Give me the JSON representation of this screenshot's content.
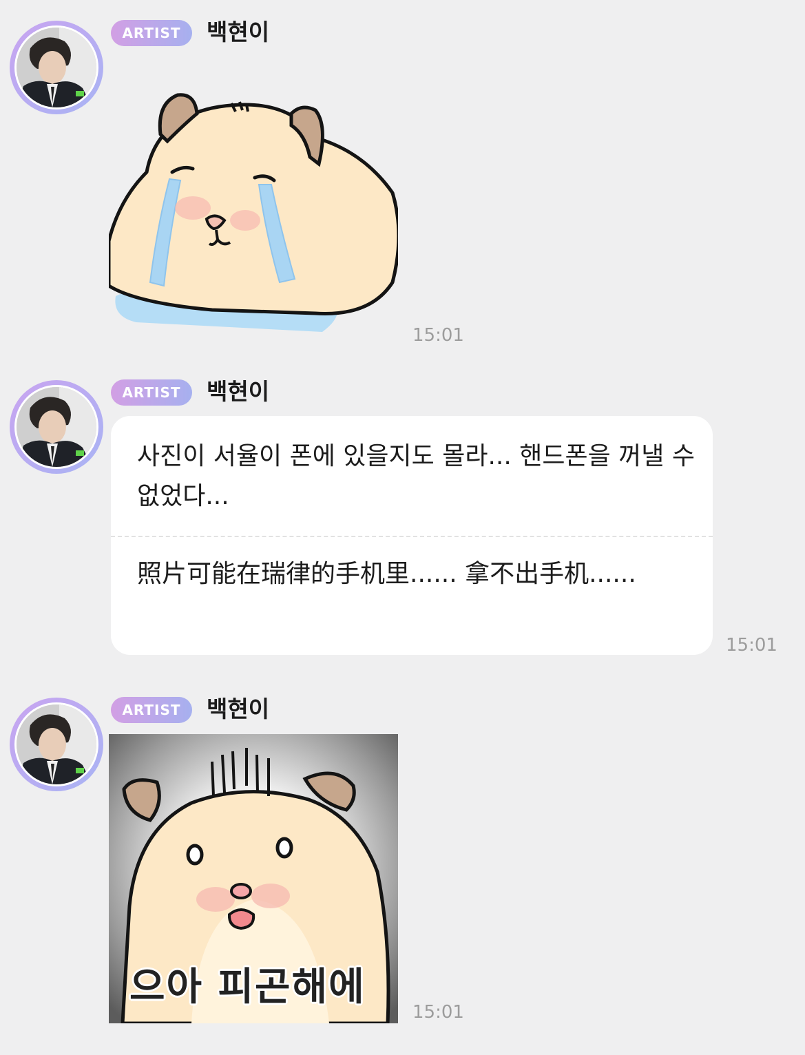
{
  "messages": [
    {
      "badge": "ARTIST",
      "sender": "백현이",
      "type": "sticker",
      "sticker_icon": "crying-hamster-sticker",
      "time": "15:01"
    },
    {
      "badge": "ARTIST",
      "sender": "백현이",
      "type": "text",
      "text_korean": "사진이 서율이 폰에 있을지도 몰라... 핸드폰을 꺼낼 수 없었다...",
      "text_chinese": "照片可能在瑞律的手机里...... 拿不出手机......",
      "time": "15:01"
    },
    {
      "badge": "ARTIST",
      "sender": "백현이",
      "type": "sticker",
      "sticker_icon": "shocked-hamster-sticker",
      "sticker_caption": "으아 피곤해에",
      "time": "15:01"
    }
  ],
  "colors": {
    "background": "#efeff0",
    "bubble": "#ffffff",
    "badge_gradient_start": "#d29fe4",
    "badge_gradient_end": "#a6b0ef",
    "timestamp": "#9c9c9c"
  }
}
